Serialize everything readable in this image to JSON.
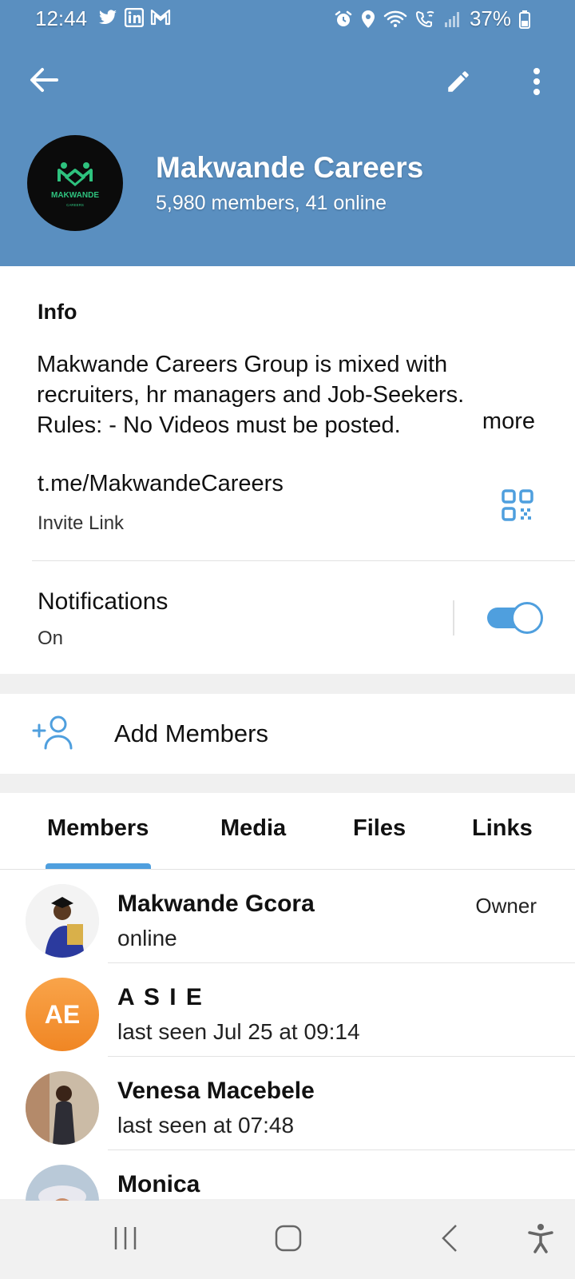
{
  "status_bar": {
    "time": "12:44",
    "battery": "37%",
    "app_icons": [
      "twitter-icon",
      "linkedin-icon",
      "gmail-icon"
    ],
    "system_icons": [
      "alarm-icon",
      "location-icon",
      "wifi-icon",
      "wifi-call-icon",
      "signal-icon",
      "battery-icon"
    ]
  },
  "header": {
    "title": "Makwande Careers",
    "subtitle": "5,980 members, 41 online",
    "avatar_text": "MAKWANDE",
    "avatar_subtext": "CAREERS",
    "accent_color": "#5a8fc0"
  },
  "info": {
    "label": "Info",
    "line1": "Makwande Careers Group is mixed with",
    "line2": "recruiters, hr managers and Job-Seekers.",
    "line3": "Rules:   - No Videos must be posted.",
    "more": "more",
    "link": "t.me/MakwandeCareers",
    "link_label": "Invite Link"
  },
  "notifications": {
    "title": "Notifications",
    "status": "On",
    "enabled": true
  },
  "add_members": {
    "label": "Add Members"
  },
  "tabs": {
    "members": "Members",
    "media": "Media",
    "files": "Files",
    "links": "Links",
    "active": "Members"
  },
  "members": [
    {
      "name": "Makwande Gcora",
      "status": "online",
      "role": "Owner"
    },
    {
      "name": "A S I E",
      "status": "last seen Jul 25 at 09:14",
      "initials": "AE"
    },
    {
      "name": "Venesa Macebele",
      "status": "last seen at 07:48"
    },
    {
      "name": "Monica",
      "status": ""
    }
  ]
}
